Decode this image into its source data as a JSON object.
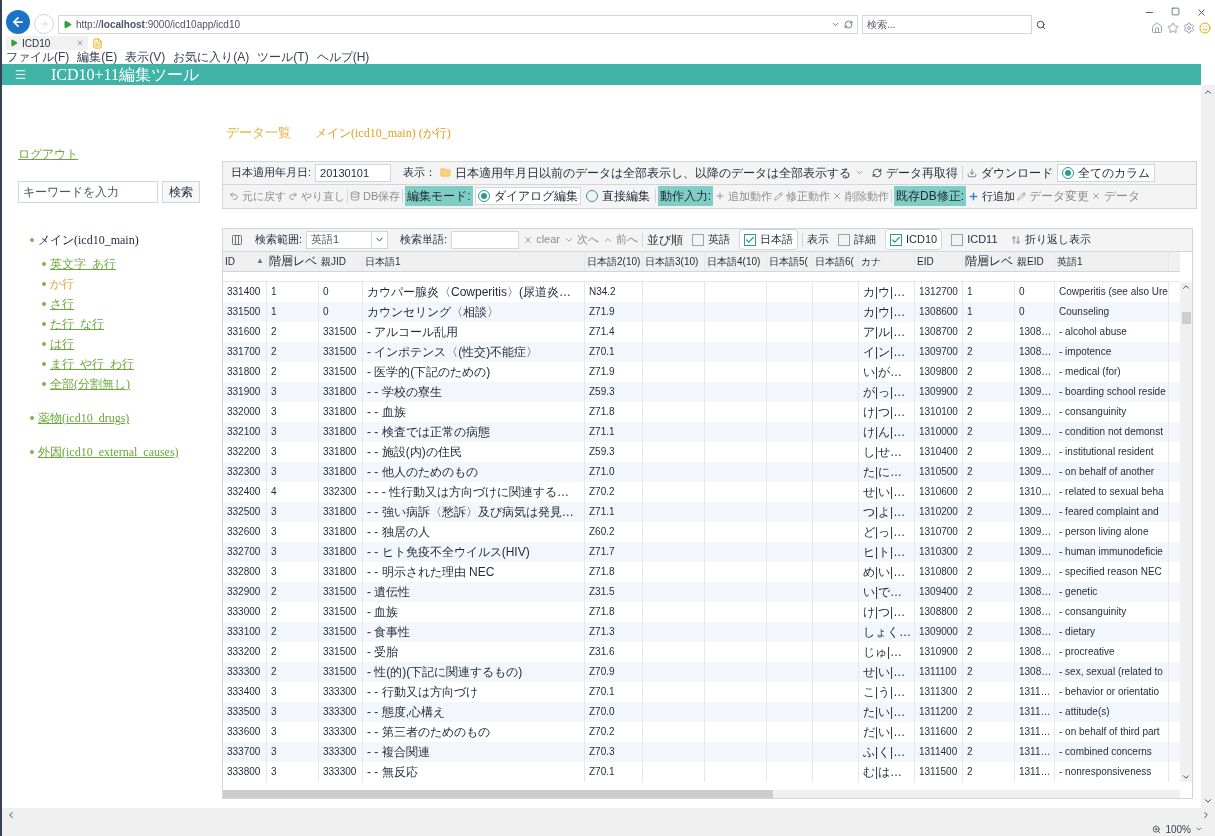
{
  "browser": {
    "address": "http://**localhost**:9000/icd10app/icd10",
    "search_placeholder": "検索...",
    "tab": {
      "title": "ICD10"
    },
    "menu": [
      "ファイル(F)",
      "編集(E)",
      "表示(V)",
      "お気に入り(A)",
      "ツール(T)",
      "ヘルプ(H)"
    ],
    "zoom": "100%"
  },
  "app": {
    "title": "ICD10+11編集ツール"
  },
  "sidebar": {
    "logout": "ログアウト",
    "search_placeholder": "キーワードを入力",
    "search_button": "検索",
    "tree": [
      {
        "label": "メイン(icd10_main)",
        "selected": true,
        "children": [
          {
            "label": "英文字_あ行",
            "selected": false
          },
          {
            "label": "か行",
            "selected": true
          },
          {
            "label": "さ行",
            "selected": false
          },
          {
            "label": "た行_な行",
            "selected": false
          },
          {
            "label": "は行",
            "selected": false
          },
          {
            "label": "ま行_や行_わ行",
            "selected": false
          },
          {
            "label": "全部(分割無し)",
            "selected": false
          }
        ]
      },
      {
        "label": "薬物(icd10_drugs)",
        "selected": false
      },
      {
        "label": "外因(icd10_external_causes)",
        "selected": false
      }
    ]
  },
  "heading": {
    "title": "データ一覧",
    "subtitle": "メイン(icd10_main) (か行)"
  },
  "toolbar": {
    "date_label": "日本適用年月日:",
    "date_value": "20130101",
    "display_label": "表示：",
    "display_filter": "日本適用年月日以前のデータは全部表示し、以降のデータは全部表示する",
    "refresh": "データ再取得",
    "download": "ダウンロード",
    "all_columns": {
      "label": "全てのカラム",
      "selected": true
    }
  },
  "edit_bar": {
    "undo": {
      "label": "元に戻す",
      "disabled": true
    },
    "redo": {
      "label": "やり直し",
      "disabled": true
    },
    "db_save": {
      "label": "DB保存",
      "disabled": true
    },
    "edit_mode_tag": "編集モード:",
    "edit_modes": [
      {
        "label": "ダイアログ編集",
        "selected": true
      },
      {
        "label": "直接編集",
        "selected": false
      }
    ],
    "action_tag": "動作入力:",
    "add_action": {
      "label": "追加動作",
      "disabled": true
    },
    "modify_action": {
      "label": "修正動作",
      "disabled": true
    },
    "delete_action": {
      "label": "削除動作",
      "disabled": true
    },
    "db_fix_tag": "既存DB修正:",
    "add_row": {
      "label": "行追加",
      "disabled": false
    },
    "change_data": {
      "label": "データ変更",
      "disabled": true
    },
    "delete_data": {
      "label": "データ",
      "disabled": true
    }
  },
  "grid_bar": {
    "search_scope_label": "検索範囲:",
    "search_scope_value": "英語1",
    "search_word_label": "検索単語:",
    "clear": {
      "label": "clear",
      "disabled": true
    },
    "next": {
      "label": "次へ",
      "disabled": true
    },
    "prev": {
      "label": "前へ",
      "disabled": true
    },
    "sort_label": "並び順",
    "sort_options": [
      {
        "label": "英語",
        "checked": false
      },
      {
        "label": "日本語",
        "checked": true
      }
    ],
    "view_label": "表示",
    "view_options": [
      {
        "label": "詳細",
        "checked": false
      },
      {
        "label": "ICD10",
        "checked": true
      },
      {
        "label": "ICD11",
        "checked": false
      }
    ],
    "wrap": "折り返し表示"
  },
  "table": {
    "columns": [
      {
        "label": "ID",
        "sort_indicator": "▲"
      },
      {
        "label": "階層レベ"
      },
      {
        "label": "親JID"
      },
      {
        "label": "日本語1"
      },
      {
        "label": "日本語2(10)"
      },
      {
        "label": "日本語3(10)"
      },
      {
        "label": "日本語4(10)"
      },
      {
        "label": "日本語5("
      },
      {
        "label": "日本語6("
      },
      {
        "label": "カナ"
      },
      {
        "label": "EID"
      },
      {
        "label": "階層レベ"
      },
      {
        "label": "親EID"
      },
      {
        "label": "英語1"
      }
    ],
    "rows": [
      {
        "jid": "331400",
        "level": "1",
        "parent_jid": "0",
        "japanese_1": "カウパー腺炎〈Cowperitis〉(尿道炎…",
        "japanese_2": "N34.2",
        "kana": "カ|ウ|…",
        "eid": "1312700",
        "eid_level": "1",
        "parent_eid": "0",
        "english_1": "Cowperitis (see also Ure"
      },
      {
        "jid": "331500",
        "level": "1",
        "parent_jid": "0",
        "japanese_1": "カウンセリング〈相談〉",
        "japanese_2": "Z71.9",
        "kana": "カ|ウ|…",
        "eid": "1308600",
        "eid_level": "1",
        "parent_eid": "0",
        "english_1": "Counseling"
      },
      {
        "jid": "331600",
        "level": "2",
        "parent_jid": "331500",
        "japanese_1": "- アルコール乱用",
        "japanese_2": "Z71.4",
        "kana": "ア|ル|…",
        "eid": "1308700",
        "eid_level": "2",
        "parent_eid": "1308…",
        "english_1": "- alcohol abuse"
      },
      {
        "jid": "331700",
        "level": "2",
        "parent_jid": "331500",
        "japanese_1": "- インポテンス〈(性交)不能症〉",
        "japanese_2": "Z70.1",
        "kana": "イ|ン|…",
        "eid": "1309700",
        "eid_level": "2",
        "parent_eid": "1308…",
        "english_1": "- impotence"
      },
      {
        "jid": "331800",
        "level": "2",
        "parent_jid": "331500",
        "japanese_1": "- 医学的(下記のための)",
        "japanese_2": "Z71.9",
        "kana": "い|が…",
        "eid": "1309800",
        "eid_level": "2",
        "parent_eid": "1308…",
        "english_1": "- medical (for)"
      },
      {
        "jid": "331900",
        "level": "3",
        "parent_jid": "331800",
        "japanese_1": "- - 学校の寮生",
        "japanese_2": "Z59.3",
        "kana": "が|っ|…",
        "eid": "1309900",
        "eid_level": "2",
        "parent_eid": "1309…",
        "english_1": "- boarding school reside"
      },
      {
        "jid": "332000",
        "level": "3",
        "parent_jid": "331800",
        "japanese_1": "- - 血族",
        "japanese_2": "Z71.8",
        "kana": "け|つ|…",
        "eid": "1310100",
        "eid_level": "2",
        "parent_eid": "1309…",
        "english_1": "- consanguinity"
      },
      {
        "jid": "332100",
        "level": "3",
        "parent_jid": "331800",
        "japanese_1": "- - 検査では正常の病態",
        "japanese_2": "Z71.1",
        "kana": "け|ん|…",
        "eid": "1310000",
        "eid_level": "2",
        "parent_eid": "1309…",
        "english_1": "- condition not demonst"
      },
      {
        "jid": "332200",
        "level": "3",
        "parent_jid": "331800",
        "japanese_1": "- - 施設(内)の住民",
        "japanese_2": "Z59.3",
        "kana": "し|せ…",
        "eid": "1310400",
        "eid_level": "2",
        "parent_eid": "1309…",
        "english_1": "- institutional resident"
      },
      {
        "jid": "332300",
        "level": "3",
        "parent_jid": "331800",
        "japanese_1": "- - 他人のためのもの",
        "japanese_2": "Z71.0",
        "kana": "た|に…",
        "eid": "1310500",
        "eid_level": "2",
        "parent_eid": "1309…",
        "english_1": "- on behalf of another"
      },
      {
        "jid": "332400",
        "level": "4",
        "parent_jid": "332300",
        "japanese_1": "- - - 性行動又は方向づけに関連する…",
        "japanese_2": "Z70.2",
        "kana": "せ|い|…",
        "eid": "1310600",
        "eid_level": "2",
        "parent_eid": "1310…",
        "english_1": "- related to sexual beha"
      },
      {
        "jid": "332500",
        "level": "3",
        "parent_jid": "331800",
        "japanese_1": "- - 強い病訴〈愁訴〉及び病気は発見…",
        "japanese_2": "Z71.1",
        "kana": "つ|よ|…",
        "eid": "1310200",
        "eid_level": "2",
        "parent_eid": "1309…",
        "english_1": "- feared complaint and"
      },
      {
        "jid": "332600",
        "level": "3",
        "parent_jid": "331800",
        "japanese_1": "- - 独居の人",
        "japanese_2": "Z60.2",
        "kana": "ど|っ|…",
        "eid": "1310700",
        "eid_level": "2",
        "parent_eid": "1309…",
        "english_1": "- person living alone"
      },
      {
        "jid": "332700",
        "level": "3",
        "parent_jid": "331800",
        "japanese_1": "- - ヒト免疫不全ウイルス(HIV)",
        "japanese_2": "Z71.7",
        "kana": "ヒ|ト|…",
        "eid": "1310300",
        "eid_level": "2",
        "parent_eid": "1309…",
        "english_1": "- human immunodeficie"
      },
      {
        "jid": "332800",
        "level": "3",
        "parent_jid": "331800",
        "japanese_1": "- - 明示された理由 NEC",
        "japanese_2": "Z71.8",
        "kana": "め|い|…",
        "eid": "1310800",
        "eid_level": "2",
        "parent_eid": "1309…",
        "english_1": "- specified reason NEC"
      },
      {
        "jid": "332900",
        "level": "2",
        "parent_jid": "331500",
        "japanese_1": "- 遺伝性",
        "japanese_2": "Z31.5",
        "kana": "い|で…",
        "eid": "1309400",
        "eid_level": "2",
        "parent_eid": "1308…",
        "english_1": "- genetic"
      },
      {
        "jid": "333000",
        "level": "2",
        "parent_jid": "331500",
        "japanese_1": "- 血族",
        "japanese_2": "Z71.8",
        "kana": "け|つ|…",
        "eid": "1308800",
        "eid_level": "2",
        "parent_eid": "1308…",
        "english_1": "- consanguinity"
      },
      {
        "jid": "333100",
        "level": "2",
        "parent_jid": "331500",
        "japanese_1": "- 食事性",
        "japanese_2": "Z71.3",
        "kana": "しょく…",
        "eid": "1309000",
        "eid_level": "2",
        "parent_eid": "1308…",
        "english_1": "- dietary"
      },
      {
        "jid": "333200",
        "level": "2",
        "parent_jid": "331500",
        "japanese_1": "- 受胎",
        "japanese_2": "Z31.6",
        "kana": "じゅ|…",
        "eid": "1310900",
        "eid_level": "2",
        "parent_eid": "1308…",
        "english_1": "- procreative"
      },
      {
        "jid": "333300",
        "level": "2",
        "parent_jid": "331500",
        "japanese_1": "- 性(的)(下記に関連するもの)",
        "japanese_2": "Z70.9",
        "kana": "せ|い|…",
        "eid": "1311100",
        "eid_level": "2",
        "parent_eid": "1308…",
        "english_1": "- sex, sexual (related to"
      },
      {
        "jid": "333400",
        "level": "3",
        "parent_jid": "333300",
        "japanese_1": "- - 行動又は方向づけ",
        "japanese_2": "Z70.1",
        "kana": "こ|う|…",
        "eid": "1311300",
        "eid_level": "2",
        "parent_eid": "1311…",
        "english_1": "- behavior or orientatio"
      },
      {
        "jid": "333500",
        "level": "3",
        "parent_jid": "333300",
        "japanese_1": "- - 態度,心構え",
        "japanese_2": "Z70.0",
        "kana": "た|い|…",
        "eid": "1311200",
        "eid_level": "2",
        "parent_eid": "1311…",
        "english_1": "- attitude(s)"
      },
      {
        "jid": "333600",
        "level": "3",
        "parent_jid": "333300",
        "japanese_1": "- - 第三者のためのもの",
        "japanese_2": "Z70.2",
        "kana": "だ|い|…",
        "eid": "1311600",
        "eid_level": "2",
        "parent_eid": "1311…",
        "english_1": "- on behalf of third part"
      },
      {
        "jid": "333700",
        "level": "3",
        "parent_jid": "333300",
        "japanese_1": "- - 複合関連",
        "japanese_2": "Z70.3",
        "kana": "ふ|く|…",
        "eid": "1311400",
        "eid_level": "2",
        "parent_eid": "1311…",
        "english_1": "- combined concerns"
      },
      {
        "jid": "333800",
        "level": "3",
        "parent_jid": "333300",
        "japanese_1": "- - 無反応",
        "japanese_2": "Z70.1",
        "kana": "む|は…",
        "eid": "1311500",
        "eid_level": "2",
        "parent_eid": "1311…",
        "english_1": "- nonresponsiveness"
      }
    ]
  }
}
